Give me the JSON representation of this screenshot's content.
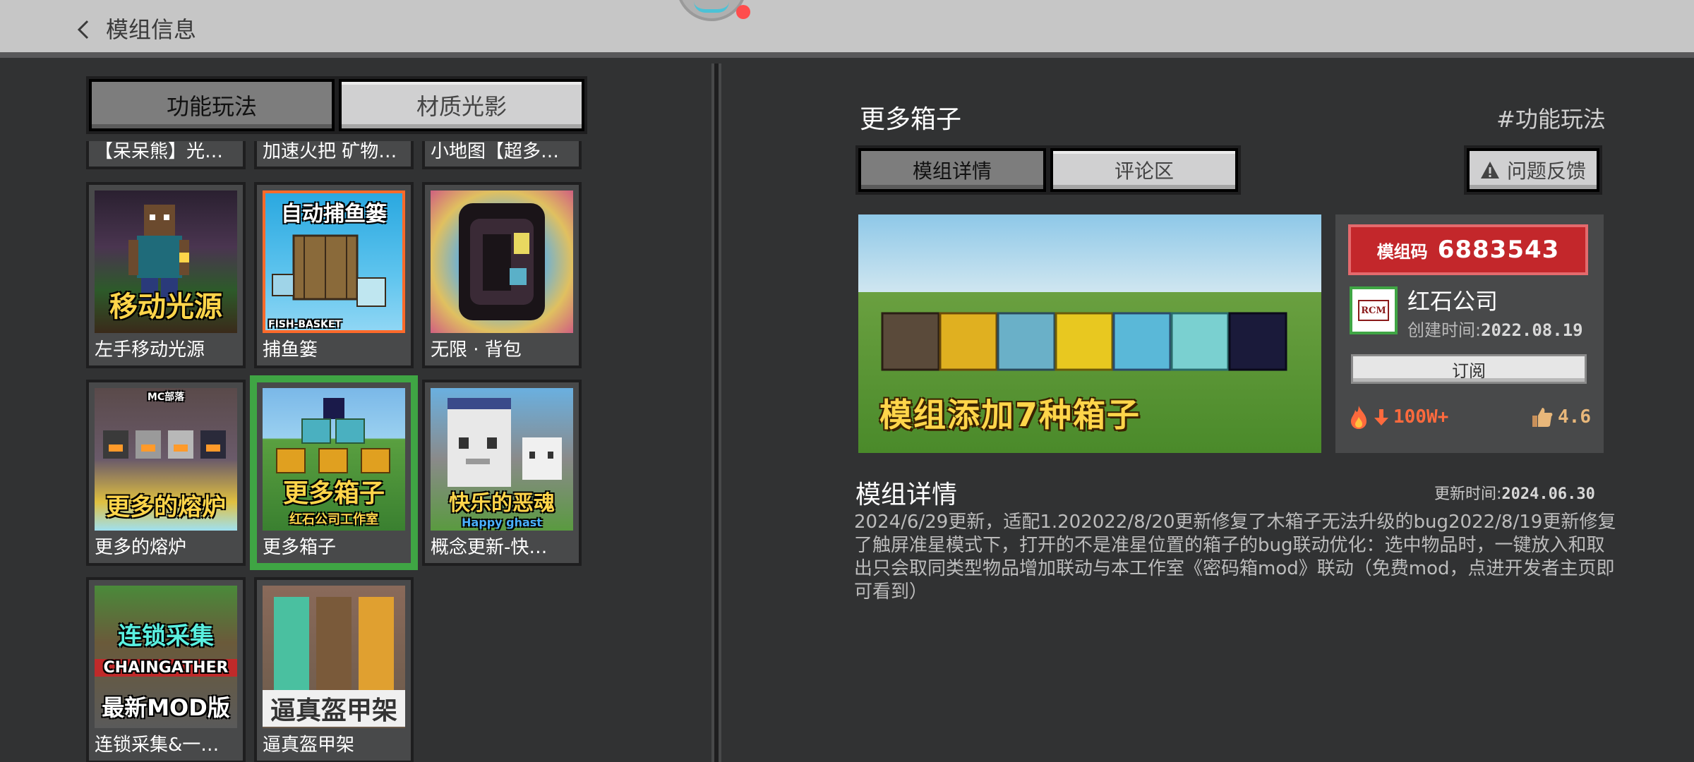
{
  "header": {
    "title": "模组信息"
  },
  "category_tabs": [
    {
      "label": "功能玩法",
      "active": true
    },
    {
      "label": "材质光影",
      "active": false
    }
  ],
  "partial_cards": [
    {
      "label": "【呆呆熊】光…"
    },
    {
      "label": "加速火把 矿物…"
    },
    {
      "label": "小地图【超多…"
    }
  ],
  "mod_cards": [
    {
      "label": "左手移动光源",
      "thumb_text": "移动光源",
      "selected": false
    },
    {
      "label": "捕鱼篓",
      "thumb_text": "自动捕鱼篓",
      "thumb_subtext": "FISH-BASKET",
      "selected": false
    },
    {
      "label": "无限 · 背包",
      "thumb_text": "",
      "selected": false
    },
    {
      "label": "更多的熔炉",
      "thumb_text": "更多的熔炉",
      "thumb_subtext": "MC部落",
      "selected": false
    },
    {
      "label": "更多箱子",
      "thumb_text": "更多箱子",
      "thumb_subtext": "红石公司工作室",
      "selected": true
    },
    {
      "label": "概念更新-快…",
      "thumb_text": "快乐的恶魂",
      "thumb_subtext": "Happy ghast",
      "selected": false
    },
    {
      "label": "连锁采集&一…",
      "thumb_text": "连锁采集",
      "thumb_subtext": "CHAINGATHER",
      "thumb_text2": "最新MOD版",
      "selected": false
    },
    {
      "label": "逼真盔甲架",
      "thumb_text": "逼真盔甲架",
      "selected": false
    }
  ],
  "detail": {
    "title": "更多箱子",
    "category": "#功能玩法",
    "tabs": [
      {
        "label": "模组详情",
        "active": true
      },
      {
        "label": "评论区",
        "active": false
      }
    ],
    "feedback_label": "问题反馈",
    "preview_caption": "模组添加7种箱子",
    "code_label": "模组码",
    "code_value": "6883543",
    "author": "红石公司",
    "author_logo_text": "RCM",
    "created_label": "创建时间:",
    "created_value": "2022.08.19",
    "subscribe_label": "订阅",
    "downloads": "100W+",
    "rating": "4.6",
    "section_title": "模组详情",
    "update_label": "更新时间:",
    "update_value": "2024.06.30",
    "description": "2024/6/29更新，适配1.202022/8/20更新修复了木箱子无法升级的bug2022/8/19更新修复了触屏准星模式下，打开的不是准星位置的箱子的bug联动优化：选中物品时，一键放入和取出只会取同类型物品增加联动与本工作室《密码箱mod》联动（免费mod，点进开发者主页即可看到）"
  },
  "colors": {
    "selected_border": "#3fa544",
    "code_bg": "#c3272b",
    "accent_yellow": "#ffd54a"
  }
}
